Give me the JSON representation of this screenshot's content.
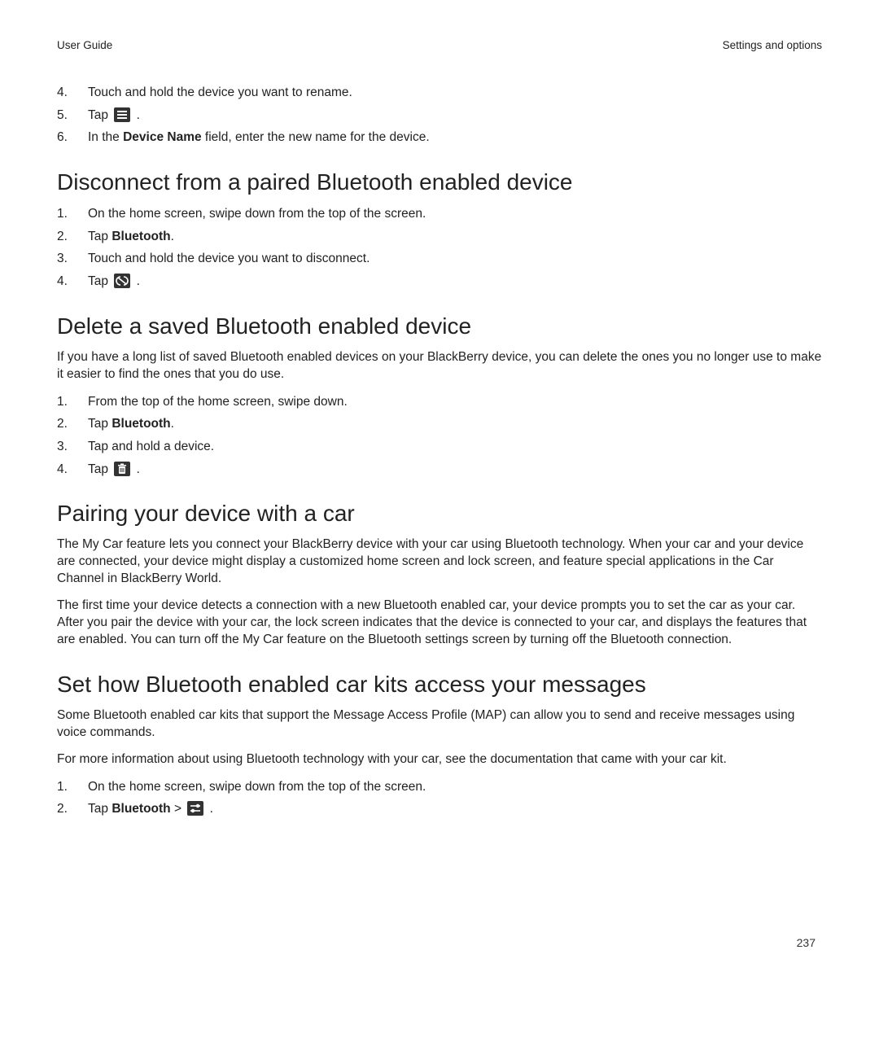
{
  "header": {
    "left": "User Guide",
    "right": "Settings and options"
  },
  "topsteps": [
    {
      "n": "4.",
      "text": "Touch and hold the device you want to rename."
    },
    {
      "n": "5.",
      "pre": "Tap ",
      "icon": "menu",
      "post": " ."
    },
    {
      "n": "6.",
      "pre": "In the ",
      "bold": "Device Name",
      "post": " field, enter the new name for the device."
    }
  ],
  "sections": {
    "disconnect": {
      "title": "Disconnect from a paired Bluetooth enabled device",
      "steps": [
        {
          "n": "1.",
          "text": "On the home screen, swipe down from the top of the screen."
        },
        {
          "n": "2.",
          "pre": "Tap ",
          "bold": "Bluetooth",
          "post": "."
        },
        {
          "n": "3.",
          "text": "Touch and hold the device you want to disconnect."
        },
        {
          "n": "4.",
          "pre": "Tap ",
          "icon": "disconnect",
          "post": " ."
        }
      ]
    },
    "delete": {
      "title": "Delete a saved Bluetooth enabled device",
      "intro": "If you have a long list of saved Bluetooth enabled devices on your BlackBerry device, you can delete the ones you no longer use to make it easier to find the ones that you do use.",
      "steps": [
        {
          "n": "1.",
          "text": "From the top of the home screen, swipe down."
        },
        {
          "n": "2.",
          "pre": "Tap ",
          "bold": "Bluetooth",
          "post": "."
        },
        {
          "n": "3.",
          "text": "Tap and hold a device."
        },
        {
          "n": "4.",
          "pre": "Tap ",
          "icon": "trash",
          "post": " ."
        }
      ]
    },
    "pairing": {
      "title": "Pairing your device with a car",
      "p1": "The My Car feature lets you connect your BlackBerry device with your car using Bluetooth technology. When your car and your device are connected, your device might display a customized home screen and lock screen, and feature special applications in the Car Channel in BlackBerry World.",
      "p2": "The first time your device detects a connection with a new Bluetooth enabled car, your device prompts you to set the car as your car. After you pair the device with your car, the lock screen indicates that the device is connected to your car, and displays the features that are enabled. You can turn off the My Car feature on the Bluetooth settings screen by turning off the Bluetooth connection."
    },
    "carkits": {
      "title": "Set how Bluetooth enabled car kits access your messages",
      "p1": "Some Bluetooth enabled car kits that support the Message Access Profile (MAP) can allow you to send and receive messages using voice commands.",
      "p2": "For more information about using Bluetooth technology with your car, see the documentation that came with your car kit.",
      "steps": [
        {
          "n": "1.",
          "text": "On the home screen, swipe down from the top of the screen."
        },
        {
          "n": "2.",
          "pre": "Tap ",
          "bold": "Bluetooth",
          "post1": " > ",
          "icon": "sliders",
          "post": " ."
        }
      ]
    }
  },
  "pageNumber": "237"
}
